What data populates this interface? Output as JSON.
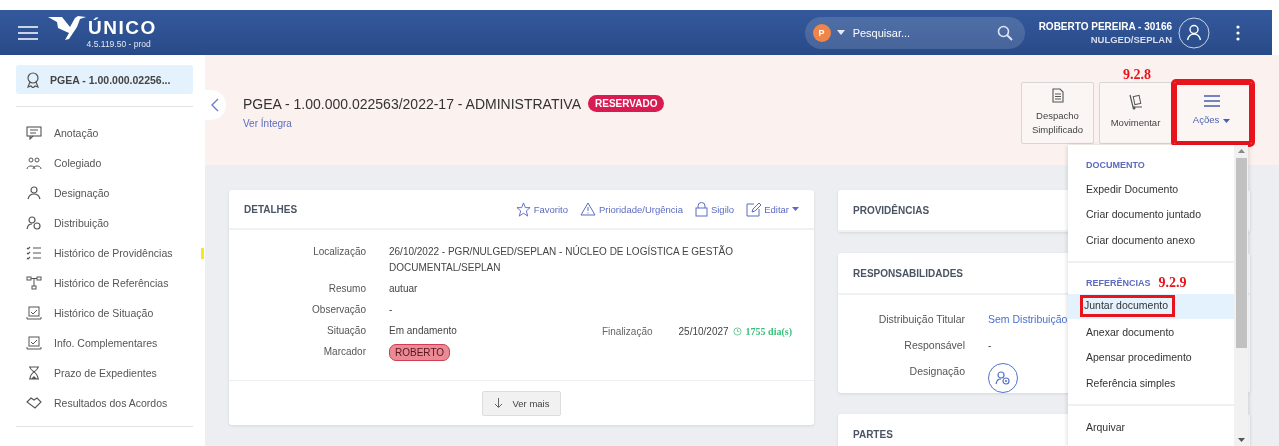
{
  "header": {
    "app_name": "ÚNICO",
    "version": "4.5.119.50 - prod",
    "search": {
      "scope": "P",
      "placeholder": "Pesquisar..."
    },
    "user": {
      "name": "ROBERTO PEREIRA - 30166",
      "unit": "NULGED/SEPLAN"
    }
  },
  "sidebar": {
    "process": {
      "label": "PGEA - 1.00.000.02256...",
      "selected": true
    },
    "items": [
      {
        "label": "Anotação",
        "marked": false
      },
      {
        "label": "Colegiado",
        "marked": false
      },
      {
        "label": "Designação",
        "marked": false
      },
      {
        "label": "Distribuição",
        "marked": false
      },
      {
        "label": "Histórico de Providências",
        "marked": true
      },
      {
        "label": "Histórico de Referências",
        "marked": false
      },
      {
        "label": "Histórico de Situação",
        "marked": false
      },
      {
        "label": "Info. Complementares",
        "marked": false
      },
      {
        "label": "Prazo de Expedientes",
        "marked": false
      },
      {
        "label": "Resultados dos Acordos",
        "marked": false
      }
    ]
  },
  "process": {
    "title": "PGEA - 1.00.000.022563/2022-17 - ADMINISTRATIVA",
    "badge": "RESERVADO",
    "link": "Ver Íntegra"
  },
  "toolbar": [
    {
      "label": "Despacho Simplificado",
      "kind": "despacho",
      "dropdown": false,
      "boxed": false
    },
    {
      "label": "Movimentar",
      "kind": "movimentar",
      "annotation": "9.2.8",
      "dropdown": false,
      "boxed": false
    },
    {
      "label": "Ações",
      "kind": "acoes",
      "dropdown": true,
      "boxed": true
    }
  ],
  "detalhes": {
    "title": "DETALHES",
    "actions": [
      {
        "label": "Favorito",
        "kind": "star",
        "dropdown": false
      },
      {
        "label": "Prioridade/Urgência",
        "kind": "warning",
        "dropdown": false
      },
      {
        "label": "Sigilo",
        "kind": "lock",
        "dropdown": false
      },
      {
        "label": "Editar",
        "kind": "edit",
        "dropdown": true
      }
    ],
    "fields": [
      {
        "label": "Localização",
        "value": "26/10/2022 - PGR/NULGED/SEPLAN - NÚCLEO DE LOGÍSTICA E GESTÃO DOCUMENTAL/SEPLAN",
        "kind": "text"
      },
      {
        "label": "Resumo",
        "value": "autuar",
        "kind": "text"
      },
      {
        "label": "Observação",
        "value": "-",
        "kind": "text"
      },
      {
        "label": "Situação",
        "value": "Em andamento",
        "kind": "text",
        "aside": {
          "label": "Finalização",
          "value": "25/10/2027",
          "days": "1755 dia(s)"
        }
      },
      {
        "label": "Marcador",
        "value": "ROBERTO",
        "kind": "tag"
      }
    ],
    "more": "Ver mais"
  },
  "providencias": {
    "title": "PROVIDÊNCIAS"
  },
  "responsabilidades": {
    "title": "RESPONSABILIDADES",
    "fields": [
      {
        "label": "Distribuição Titular",
        "value": "Sem Distribuição",
        "kind": "link"
      },
      {
        "label": "Responsável",
        "value": "-",
        "kind": "text"
      },
      {
        "label": "Designação",
        "kind": "icon_button"
      }
    ]
  },
  "partes": {
    "title": "PARTES"
  },
  "menu": {
    "sections": [
      {
        "title": "DOCUMENTO",
        "items": [
          {
            "label": "Expedir Documento",
            "selected": false,
            "boxed": false
          },
          {
            "label": "Criar documento juntado",
            "selected": false,
            "boxed": false
          },
          {
            "label": "Criar documento anexo",
            "selected": false,
            "boxed": false
          }
        ]
      },
      {
        "title": "REFERÊNCIAS",
        "annotation": "9.2.9",
        "items": [
          {
            "label": "Juntar documento",
            "selected": true,
            "boxed": true
          },
          {
            "label": "Anexar documento",
            "selected": false,
            "boxed": false
          },
          {
            "label": "Apensar procedimento",
            "selected": false,
            "boxed": false
          },
          {
            "label": "Referência simples",
            "selected": false,
            "boxed": false
          }
        ]
      },
      {
        "items": [
          {
            "label": "Arquivar",
            "selected": false,
            "boxed": false
          }
        ]
      }
    ]
  }
}
